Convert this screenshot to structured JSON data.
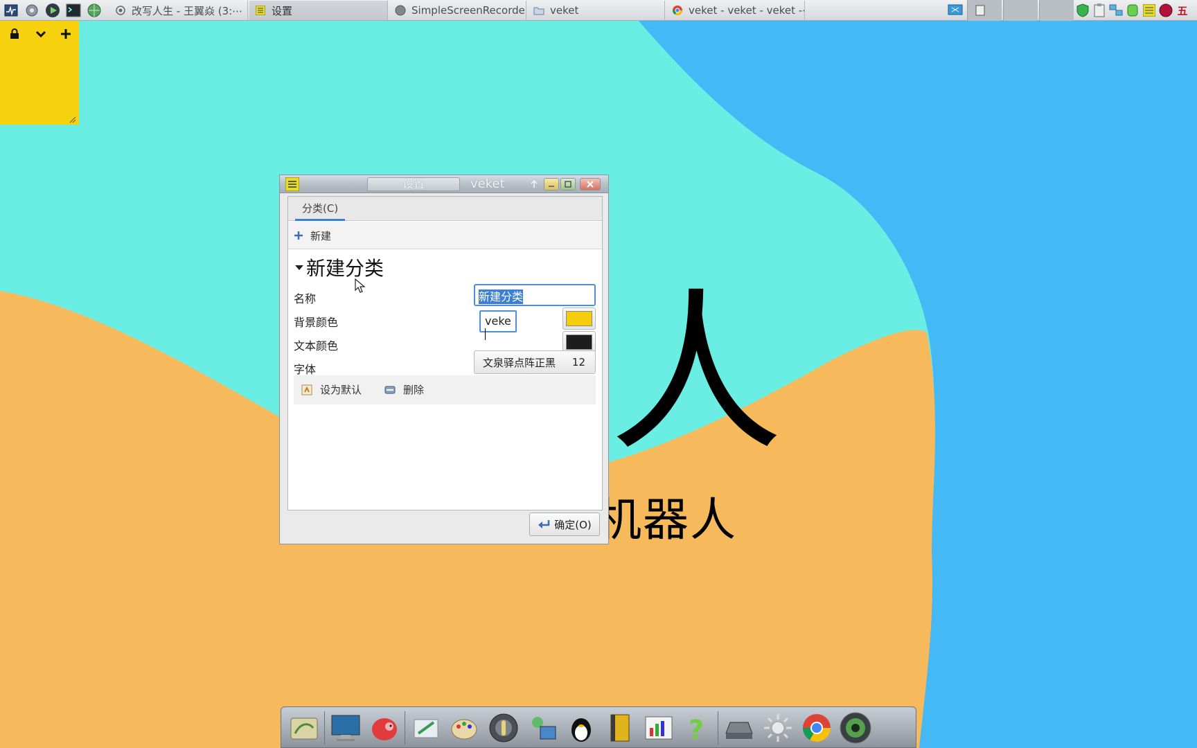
{
  "taskbar": {
    "tasks": [
      {
        "label": "改写人生 - 王翼焱 (3:⋯",
        "icon": "record-icon"
      },
      {
        "label": "设置",
        "icon": "notes-icon"
      },
      {
        "label": "SimpleScreenRecorder",
        "icon": "screen-recorder-icon"
      },
      {
        "label": "veket",
        "icon": "folder-icon"
      },
      {
        "label": "veket - veket - veket -⋯",
        "icon": "chrome-icon"
      }
    ],
    "ime_label": "五"
  },
  "wallpaper": {
    "big_char": "人",
    "subtitle": "机器人",
    "colors": {
      "cyan": "#6aeee4",
      "blue": "#44b9f5",
      "orange": "#f6b95c"
    }
  },
  "note": {
    "color": "#f6d20e"
  },
  "dialog": {
    "title_tab": "设置",
    "title_app": "veket",
    "tab_label": "分类(C)",
    "new_label": "新建",
    "section_title": "新建分类",
    "fields": {
      "name_label": "名称",
      "name_value": "新建分类",
      "bg_label": "背景颜色",
      "bg_input_value": "veke",
      "text_color_label": "文本颜色",
      "font_label": "字体",
      "font_name": "文泉驿点阵正黑",
      "font_size": "12"
    },
    "bg_color": "#f4cd0f",
    "text_color": "#1d1d1d",
    "set_default_label": "设为默认",
    "delete_label": "删除",
    "ok_label": "确定(O)"
  },
  "dock": {
    "icons": [
      "files-icon",
      "monitor-icon",
      "hedgehog-icon",
      "editor-icon",
      "paint-icon",
      "media-player-icon",
      "network-user-icon",
      "qq-penguin-icon",
      "book-icon",
      "spreadsheet-icon",
      "help-icon",
      "drive-icon",
      "settings-sun-icon",
      "chrome-icon",
      "camera-icon"
    ]
  }
}
